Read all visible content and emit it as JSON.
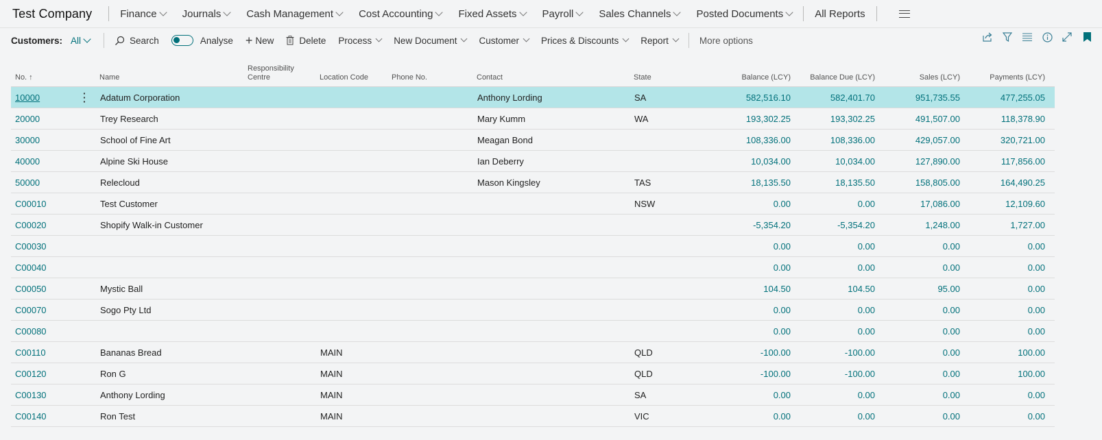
{
  "topnav": {
    "company": "Test Company",
    "items": [
      "Finance",
      "Journals",
      "Cash Management",
      "Cost Accounting",
      "Fixed Assets",
      "Payroll",
      "Sales Channels",
      "Posted Documents"
    ],
    "all_reports": "All Reports"
  },
  "actionbar": {
    "label": "Customers:",
    "filter": "All",
    "search": "Search",
    "analyse": "Analyse",
    "new": "New",
    "delete": "Delete",
    "menus": [
      "Process",
      "New Document",
      "Customer",
      "Prices & Discounts",
      "Report"
    ],
    "more": "More options",
    "icons": [
      "share-icon",
      "filter-icon",
      "list-icon",
      "info-icon",
      "expand-icon",
      "bookmark-icon"
    ]
  },
  "columns": {
    "no": "No. ↑",
    "name": "Name",
    "resp1": "Responsibility",
    "resp2": "Centre",
    "loc": "Location Code",
    "phone": "Phone No.",
    "contact": "Contact",
    "state": "State",
    "bal": "Balance (LCY)",
    "baldue": "Balance Due (LCY)",
    "sales": "Sales (LCY)",
    "pay": "Payments (LCY)"
  },
  "rows": [
    {
      "no": "10000",
      "name": "Adatum Corporation",
      "loc": "",
      "contact": "Anthony Lording",
      "state": "SA",
      "bal": "582,516.10",
      "baldue": "582,401.70",
      "sales": "951,735.55",
      "pay": "477,255.05"
    },
    {
      "no": "20000",
      "name": "Trey Research",
      "loc": "",
      "contact": "Mary Kumm",
      "state": "WA",
      "bal": "193,302.25",
      "baldue": "193,302.25",
      "sales": "491,507.00",
      "pay": "118,378.90"
    },
    {
      "no": "30000",
      "name": "School of Fine Art",
      "loc": "",
      "contact": "Meagan Bond",
      "state": "",
      "bal": "108,336.00",
      "baldue": "108,336.00",
      "sales": "429,057.00",
      "pay": "320,721.00"
    },
    {
      "no": "40000",
      "name": "Alpine Ski House",
      "loc": "",
      "contact": "Ian Deberry",
      "state": "",
      "bal": "10,034.00",
      "baldue": "10,034.00",
      "sales": "127,890.00",
      "pay": "117,856.00"
    },
    {
      "no": "50000",
      "name": "Relecloud",
      "loc": "",
      "contact": "Mason Kingsley",
      "state": "TAS",
      "bal": "18,135.50",
      "baldue": "18,135.50",
      "sales": "158,805.00",
      "pay": "164,490.25"
    },
    {
      "no": "C00010",
      "name": "Test Customer",
      "loc": "",
      "contact": "",
      "state": "NSW",
      "bal": "0.00",
      "baldue": "0.00",
      "sales": "17,086.00",
      "pay": "12,109.60"
    },
    {
      "no": "C00020",
      "name": "Shopify Walk-in Customer",
      "loc": "",
      "contact": "",
      "state": "",
      "bal": "-5,354.20",
      "baldue": "-5,354.20",
      "sales": "1,248.00",
      "pay": "1,727.00"
    },
    {
      "no": "C00030",
      "name": "",
      "loc": "",
      "contact": "",
      "state": "",
      "bal": "0.00",
      "baldue": "0.00",
      "sales": "0.00",
      "pay": "0.00"
    },
    {
      "no": "C00040",
      "name": "",
      "loc": "",
      "contact": "",
      "state": "",
      "bal": "0.00",
      "baldue": "0.00",
      "sales": "0.00",
      "pay": "0.00"
    },
    {
      "no": "C00050",
      "name": "Mystic Ball",
      "loc": "",
      "contact": "",
      "state": "",
      "bal": "104.50",
      "baldue": "104.50",
      "sales": "95.00",
      "pay": "0.00"
    },
    {
      "no": "C00070",
      "name": "Sogo Pty Ltd",
      "loc": "",
      "contact": "",
      "state": "",
      "bal": "0.00",
      "baldue": "0.00",
      "sales": "0.00",
      "pay": "0.00"
    },
    {
      "no": "C00080",
      "name": "",
      "loc": "",
      "contact": "",
      "state": "",
      "bal": "0.00",
      "baldue": "0.00",
      "sales": "0.00",
      "pay": "0.00"
    },
    {
      "no": "C00110",
      "name": "Bananas Bread",
      "loc": "MAIN",
      "contact": "",
      "state": "QLD",
      "bal": "-100.00",
      "baldue": "-100.00",
      "sales": "0.00",
      "pay": "100.00"
    },
    {
      "no": "C00120",
      "name": "Ron G",
      "loc": "MAIN",
      "contact": "",
      "state": "QLD",
      "bal": "-100.00",
      "baldue": "-100.00",
      "sales": "0.00",
      "pay": "100.00"
    },
    {
      "no": "C00130",
      "name": "Anthony Lording",
      "loc": "MAIN",
      "contact": "",
      "state": "SA",
      "bal": "0.00",
      "baldue": "0.00",
      "sales": "0.00",
      "pay": "0.00"
    },
    {
      "no": "C00140",
      "name": "Ron  Test",
      "loc": "MAIN",
      "contact": "",
      "state": "VIC",
      "bal": "0.00",
      "baldue": "0.00",
      "sales": "0.00",
      "pay": "0.00"
    }
  ],
  "selected_row": 0,
  "colors": {
    "accent": "#00707a",
    "selected": "#b3e5e8"
  }
}
